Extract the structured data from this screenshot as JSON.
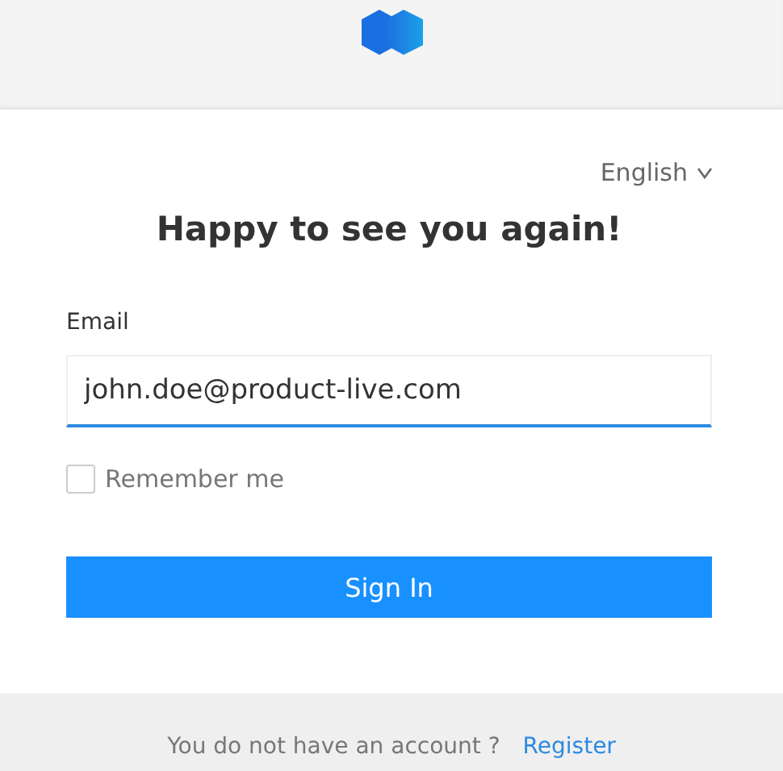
{
  "language": {
    "label": "English"
  },
  "title": "Happy to see you again!",
  "email": {
    "label": "Email",
    "value": "john.doe@product-live.com"
  },
  "remember": {
    "label": "Remember me",
    "checked": false
  },
  "sign_in": {
    "label": "Sign In"
  },
  "footer": {
    "text": "You do not have an account ?",
    "link": "Register"
  }
}
